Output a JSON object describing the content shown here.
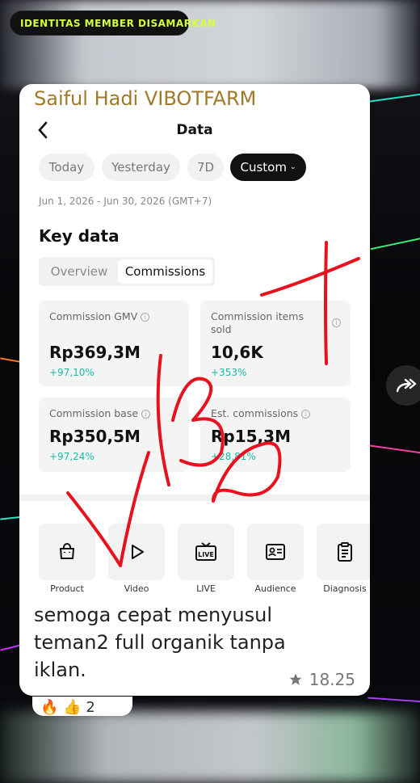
{
  "overlay_label": "IDENTITAS MEMBER DISAMARKAN",
  "chat": {
    "sender": "Saiful Hadi VIBOTFARM",
    "message": "semoga cepat menyusul teman2 full organik tanpa iklan.",
    "star_icon": "star-icon",
    "time": "18.25",
    "reactions": [
      "🔥",
      "👍"
    ],
    "reaction_count": "2"
  },
  "screenshot": {
    "header_title": "Data",
    "date_chips": [
      {
        "label": "Today",
        "active": false
      },
      {
        "label": "Yesterday",
        "active": false
      },
      {
        "label": "7D",
        "active": false
      },
      {
        "label": "Custom",
        "active": true
      }
    ],
    "date_range": "Jun 1, 2026 - Jun 30, 2026 (GMT+7)",
    "section_title": "Key data",
    "tabs": [
      {
        "label": "Overview",
        "active": false
      },
      {
        "label": "Commissions",
        "active": true
      }
    ],
    "metrics": [
      {
        "label": "Commission GMV",
        "value": "Rp369,3M",
        "change": "+97,10%"
      },
      {
        "label": "Commission items sold",
        "value": "10,6K",
        "change": "+353%"
      },
      {
        "label": "Commission base",
        "value": "Rp350,5M",
        "change": "+97,24%"
      },
      {
        "label": "Est. commissions",
        "value": "Rp15,3M",
        "change": "+28,81%"
      }
    ],
    "tools": [
      {
        "label": "Product",
        "icon": "shopping-bag-icon"
      },
      {
        "label": "Video",
        "icon": "play-icon"
      },
      {
        "label": "LIVE",
        "icon": "live-tv-icon"
      },
      {
        "label": "Audience",
        "icon": "id-card-icon"
      },
      {
        "label": "Diagnosis",
        "icon": "clipboard-icon"
      }
    ],
    "watermark_scribble": "VIBOT",
    "accent_color": "#1db9a5",
    "scribble_color": "#e8121f"
  }
}
